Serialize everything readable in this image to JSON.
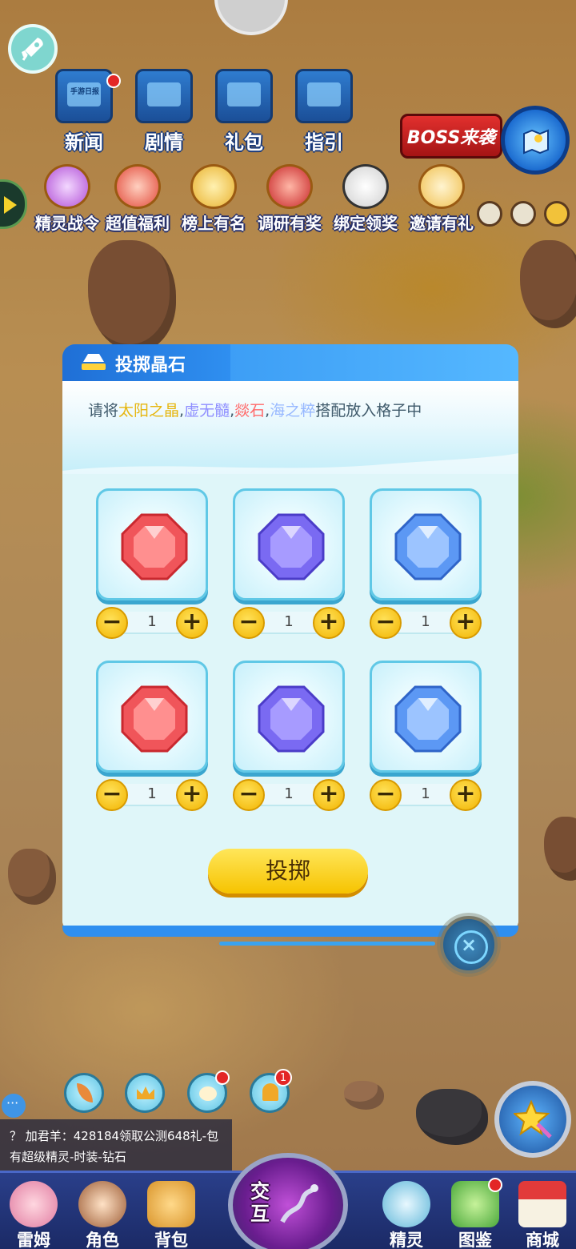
{
  "top_menu": [
    {
      "label": "新闻",
      "icon": "newspaper-icon",
      "has_dot": true
    },
    {
      "label": "剧情",
      "icon": "story-chest-icon",
      "has_dot": false
    },
    {
      "label": "礼包",
      "icon": "gift-chest-icon",
      "has_dot": false
    },
    {
      "label": "指引",
      "icon": "guide-chest-icon",
      "has_dot": false
    }
  ],
  "news_screen_text": "手游日报",
  "boss_badge": "BOSS来袭",
  "activities": [
    {
      "label": "精灵战令",
      "icon": "battle-pass-icon"
    },
    {
      "label": "超值福利",
      "icon": "gift-box-icon"
    },
    {
      "label": "榜上有名",
      "icon": "trophy-icon"
    },
    {
      "label": "调研有奖",
      "icon": "survey-chest-icon"
    },
    {
      "label": "绑定领奖",
      "icon": "panda-icon"
    },
    {
      "label": "邀请有礼",
      "icon": "invite-letter-icon"
    }
  ],
  "dialog": {
    "title": "投掷晶石",
    "instruction": {
      "prefix": "请将",
      "sun": "太阳之晶",
      "sep1": ",",
      "void": "虚无髓",
      "sep2": ",",
      "fire": "燚石",
      "sep3": ",",
      "sea": "海之粹",
      "suffix": "搭配放入格子中"
    },
    "slots": [
      {
        "gem": "red-gem",
        "count": "1"
      },
      {
        "gem": "purple-gem",
        "count": "1"
      },
      {
        "gem": "blue-gem",
        "count": "1"
      },
      {
        "gem": "red-gem",
        "count": "1"
      },
      {
        "gem": "purple-gem",
        "count": "1"
      },
      {
        "gem": "blue-gem",
        "count": "1"
      }
    ],
    "minus": "−",
    "plus": "+",
    "throw_button": "投掷",
    "close": "×"
  },
  "bottom_round_buttons": [
    {
      "icon": "leaf-icon",
      "badge": ""
    },
    {
      "icon": "crown-icon",
      "badge": ""
    },
    {
      "icon": "cat-icon",
      "badge": ""
    },
    {
      "icon": "bell-icon",
      "badge": "1"
    }
  ],
  "chat": {
    "line1": "？ 加君羊：428184领取公测648礼-包",
    "line2": "有超级精灵-时装-钻石"
  },
  "nav": [
    {
      "label": "雷姆",
      "icon": "leimu-icon"
    },
    {
      "label": "角色",
      "icon": "character-icon"
    },
    {
      "label": "背包",
      "icon": "backpack-icon"
    },
    {
      "label": "交互",
      "icon": "interact-icon"
    },
    {
      "label": "精灵",
      "icon": "spirit-icon"
    },
    {
      "label": "图鉴",
      "icon": "codex-icon"
    },
    {
      "label": "商城",
      "icon": "shop-icon"
    }
  ],
  "colors": {
    "accent_blue": "#2f8ff0",
    "button_yellow": "#f6c300",
    "sun_text": "#e6b60f",
    "void_text": "#8f8fff",
    "fire_text": "#ff6a6a",
    "sea_text": "#98b9ff",
    "nav_bg": "#1b2a66"
  }
}
